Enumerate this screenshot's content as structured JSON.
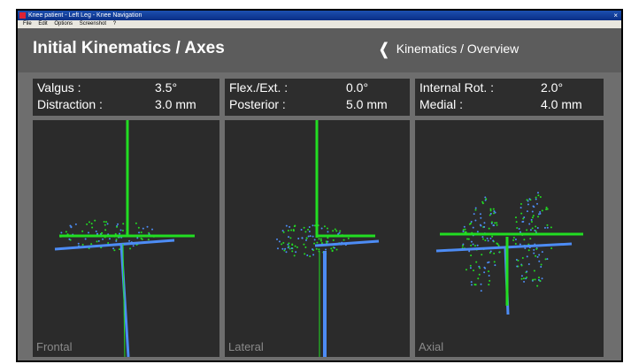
{
  "window": {
    "title": "Knee patient - Left Leg - Knee Navigation",
    "close_glyph": "×"
  },
  "menu": [
    "File",
    "Edit",
    "Options",
    "Screenshot",
    "?"
  ],
  "header": {
    "title": "Initial Kinematics / Axes",
    "back_label": "Kinematics / Overview"
  },
  "panels": [
    {
      "label": "Frontal",
      "readout": [
        {
          "label": "Valgus :",
          "value": "3.5°"
        },
        {
          "label": "Distraction :",
          "value": "3.0 mm"
        }
      ]
    },
    {
      "label": "Lateral",
      "readout": [
        {
          "label": "Flex./Ext. :",
          "value": "0.0°"
        },
        {
          "label": "Posterior :",
          "value": "5.0 mm"
        }
      ]
    },
    {
      "label": "Axial",
      "readout": [
        {
          "label": "Internal Rot. :",
          "value": "2.0°"
        },
        {
          "label": "Medial :",
          "value": "4.0 mm"
        }
      ]
    }
  ],
  "colors": {
    "femur_axis": "#22dd22",
    "tibia_axis": "#4d8cf5",
    "background": "#6e6e6e",
    "view_bg": "#2b2b2b"
  }
}
